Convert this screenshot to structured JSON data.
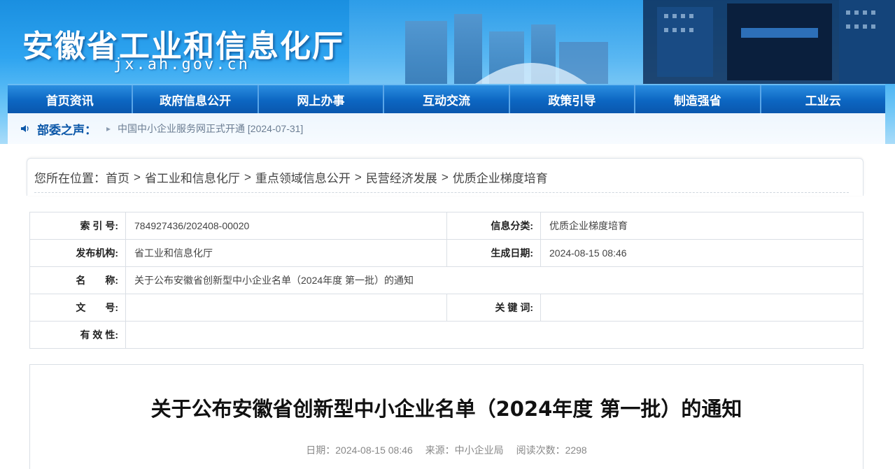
{
  "header": {
    "site_title": "安徽省工业和信息化厅",
    "site_domain": "jx.ah.gov.cn"
  },
  "nav": {
    "items": [
      {
        "label": "首页资讯"
      },
      {
        "label": "政府信息公开"
      },
      {
        "label": "网上办事"
      },
      {
        "label": "互动交流"
      },
      {
        "label": "政策引导"
      },
      {
        "label": "制造强省"
      },
      {
        "label": "工业云"
      }
    ]
  },
  "notice": {
    "label": "部委之声：",
    "link_text": "中国中小企业服务网正式开通 [2024-07-31]"
  },
  "breadcrumb": {
    "prefix": "您所在位置：",
    "items": [
      "首页",
      "省工业和信息化厅",
      "重点领域信息公开",
      "民营经济发展",
      "优质企业梯度培育"
    ],
    "separator": ">"
  },
  "meta": {
    "index_label": "索 引 号:",
    "index_value": "784927436/202408-00020",
    "category_label": "信息分类:",
    "category_value": "优质企业梯度培育",
    "publisher_label": "发布机构:",
    "publisher_value": "省工业和信息化厅",
    "date_label": "生成日期:",
    "date_value": "2024-08-15 08:46",
    "name_label": "名　　称:",
    "name_value": "关于公布安徽省创新型中小企业名单（2024年度 第一批）的通知",
    "docno_label": "文　　号:",
    "docno_value": "",
    "keywords_label": "关 键 词:",
    "keywords_value": "",
    "validity_label": "有 效 性:",
    "validity_value": ""
  },
  "article": {
    "title": "关于公布安徽省创新型中小企业名单（2024年度 第一批）的通知",
    "date": "日期：2024-08-15 08:46",
    "source": "来源：中小企业局",
    "views": "阅读次数：2298"
  },
  "colors": {
    "nav_blue": "#0c66c2",
    "notice_label": "#0b57a8",
    "banner_top": "#1a8fe0"
  }
}
